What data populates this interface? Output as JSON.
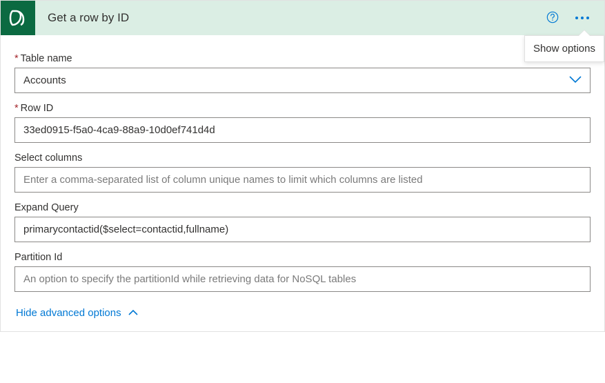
{
  "header": {
    "title": "Get a row by ID",
    "tooltip": "Show options"
  },
  "fields": {
    "tableName": {
      "label": "Table name",
      "value": "Accounts",
      "required": true
    },
    "rowId": {
      "label": "Row ID",
      "value": "33ed0915-f5a0-4ca9-88a9-10d0ef741d4d",
      "required": true
    },
    "selectColumns": {
      "label": "Select columns",
      "value": "",
      "placeholder": "Enter a comma-separated list of column unique names to limit which columns are listed"
    },
    "expandQuery": {
      "label": "Expand Query",
      "value": "primarycontactid($select=contactid,fullname)"
    },
    "partitionId": {
      "label": "Partition Id",
      "value": "",
      "placeholder": "An option to specify the partitionId while retrieving data for NoSQL tables"
    }
  },
  "toggle": {
    "label": "Hide advanced options"
  },
  "colors": {
    "headerBg": "#dbeee4",
    "iconBg": "#0b6a41",
    "accent": "#0078d4",
    "required": "#a4262c"
  }
}
